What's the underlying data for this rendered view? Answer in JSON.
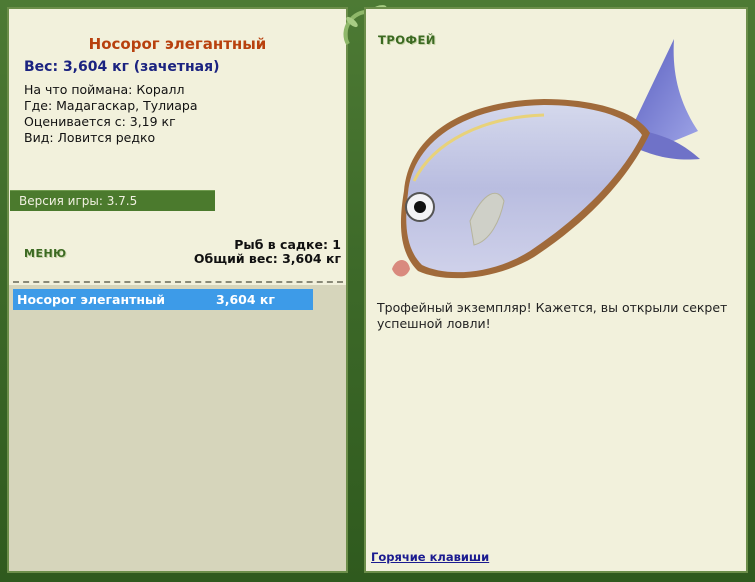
{
  "fish": {
    "name": "Носорог элегантный",
    "weight_line": "Вес: 3,604 кг (зачетная)",
    "bait": "На что поймана: Коралл",
    "location": "Где: Мадагаскар, Тулиара",
    "valued_from": "Оценивается с: 3,19 кг",
    "rarity": "Вид: Ловится редко"
  },
  "version": "Версия игры: 3.7.5",
  "menu_label": "МЕНЮ",
  "keepnet": {
    "count": "Рыб в садке: 1",
    "total": "Общий вес: 3,604 кг",
    "items": [
      {
        "name": "Носорог элегантный",
        "weight": "3,604 кг"
      }
    ]
  },
  "trophy": {
    "title": "ТРОФЕЙ",
    "text": "Трофейный экземпляр! Кажется, вы открыли секрет успешной ловли!"
  },
  "hotkeys_label": "Горячие клавиши",
  "colors": {
    "accent_green": "#4b7a2d",
    "selection_blue": "#3d9be8",
    "title_orange": "#b8410e"
  }
}
